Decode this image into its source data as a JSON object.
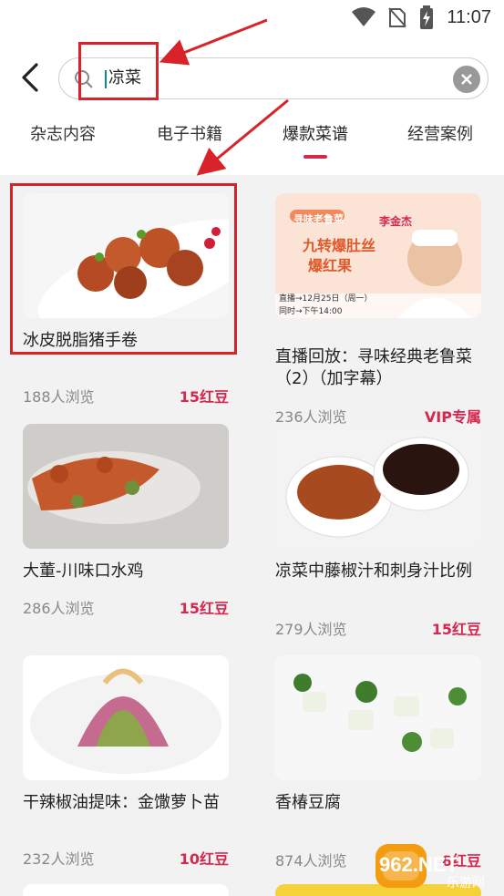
{
  "status_bar": {
    "time": "11:07"
  },
  "search": {
    "query": "凉菜"
  },
  "tabs": [
    {
      "label": "杂志内容"
    },
    {
      "label": "电子书籍"
    },
    {
      "label": "爆款菜谱"
    },
    {
      "label": "经营案例"
    }
  ],
  "active_tab_index": 2,
  "recipes": [
    {
      "title": "冰皮脱脂猪手卷",
      "views": "188人浏览",
      "price": "15红豆"
    },
    {
      "title": "直播回放：寻味经典老鲁菜（2）（加字幕）",
      "views": "236人浏览",
      "price": "VIP专属"
    },
    {
      "title": "大董-川味口水鸡",
      "views": "286人浏览",
      "price": "15红豆"
    },
    {
      "title": "凉菜中藤椒汁和刺身汁比例",
      "views": "279人浏览",
      "price": "15红豆"
    },
    {
      "title": "干辣椒油提味：金馓萝卜苗",
      "views": "232人浏览",
      "price": "10红豆"
    },
    {
      "title": "香椿豆腐",
      "views": "874人浏览",
      "price": "8红豆"
    }
  ],
  "thumb_text": {
    "live_title_1": "寻味老鲁菜",
    "live_dish_1": "九转爆肚丝",
    "live_dish_2": "爆红果",
    "live_time": "直播→12月25日（周一）",
    "live_hour": "同时→下午14:00",
    "live_chef": "李金杰"
  },
  "watermark": {
    "text": "962.NET",
    "sub": "乐游网"
  },
  "colors": {
    "accent": "#d6284f",
    "annotation": "#d8232a"
  }
}
